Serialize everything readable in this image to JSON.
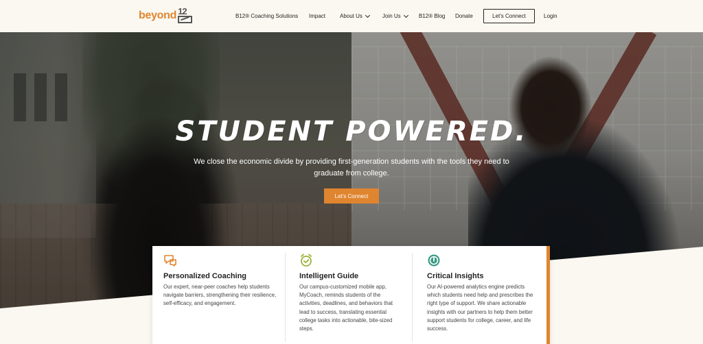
{
  "brand": {
    "word": "beyond",
    "mark_number": "12",
    "accent": "#e0852f"
  },
  "nav": {
    "items": [
      {
        "label": "B12® Coaching Solutions",
        "has_caret": false
      },
      {
        "label": "Impact",
        "has_caret": false
      },
      {
        "label": "About Us",
        "has_caret": true
      },
      {
        "label": "Join Us",
        "has_caret": true
      },
      {
        "label": "B12® Blog",
        "has_caret": false
      },
      {
        "label": "Donate",
        "has_caret": false
      }
    ],
    "connect_button": "Let's Connect",
    "login": "Login"
  },
  "hero": {
    "headline": "STUDENT POWERED.",
    "subtext": "We close the economic divide by providing first-generation students with the tools they need to graduate from college.",
    "cta": "Let's Connect"
  },
  "features": [
    {
      "icon": "chat-bubbles-icon",
      "title": "Personalized Coaching",
      "body": "Our expert, near-peer coaches help students navigate barriers, strengthening their resilience, self-efficacy, and engagement.",
      "icon_color": "#e0852f"
    },
    {
      "icon": "alarm-clock-check-icon",
      "title": "Intelligent Guide",
      "body": "Our campus-customized mobile app, MyCoach, reminds students of the activities, deadlines, and behaviors that lead to success, translating essential college tasks into actionable, bite-sized steps.",
      "icon_color": "#9bb33a"
    },
    {
      "icon": "target-insights-icon",
      "title": "Critical Insights",
      "body": "Our AI-powered analytics engine predicts which students need help and prescribes the right type of support. We share actionable insights with our partners to help them better support students for college, career, and life success.",
      "icon_color": "#3a9a86"
    }
  ]
}
